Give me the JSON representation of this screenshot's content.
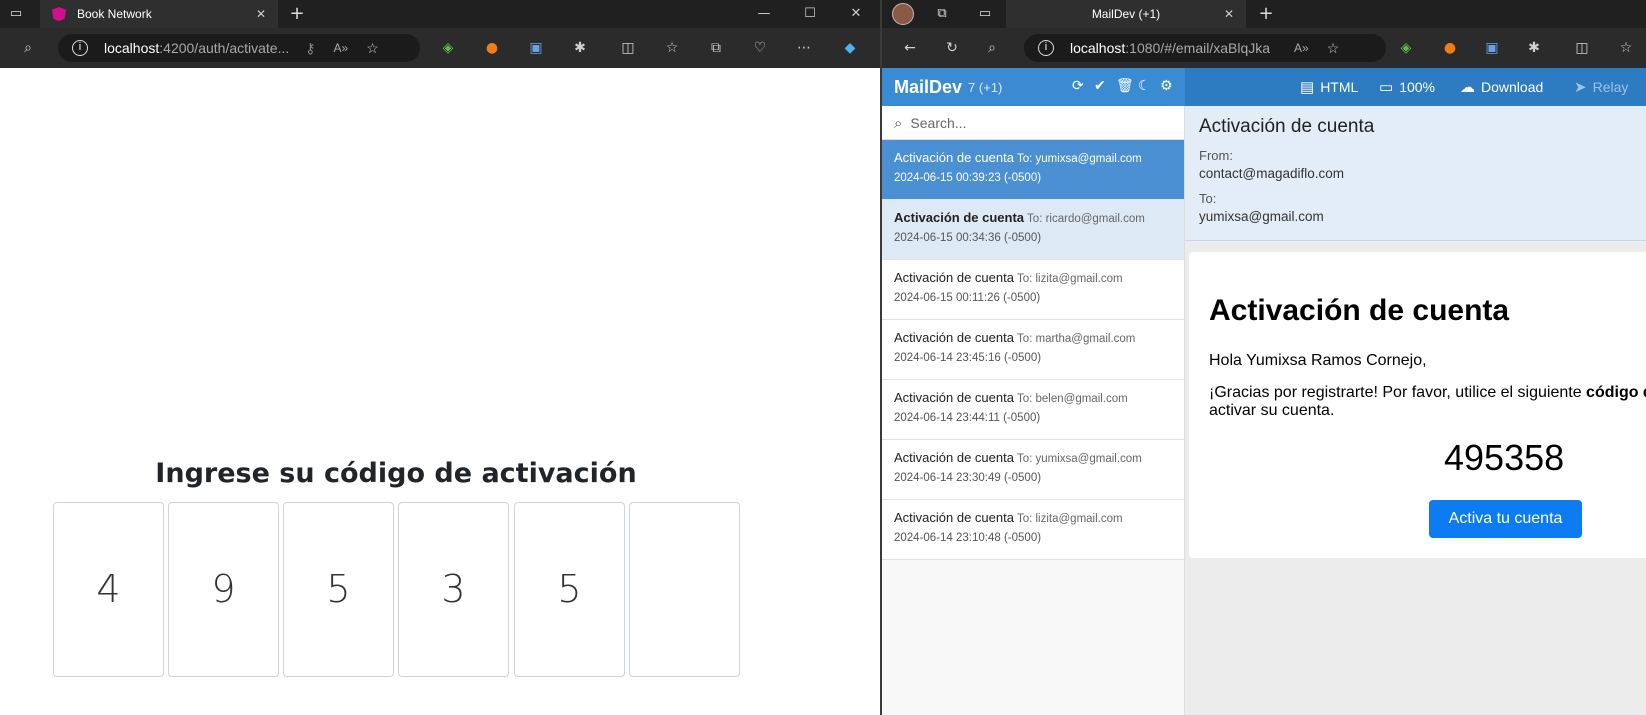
{
  "left_browser": {
    "tab_title": "Book Network",
    "url_host": "localhost",
    "url_rest": ":4200/auth/activate..."
  },
  "activation": {
    "title": "Ingrese su código de activación",
    "digits": [
      "4",
      "9",
      "5",
      "3",
      "5",
      ""
    ]
  },
  "right_browser": {
    "tab_title": "MailDev (+1)",
    "url_host": "localhost",
    "url_rest": ":1080/#/email/xaBlqJka"
  },
  "maildev": {
    "brand": "MailDev",
    "count": "7 (+1)",
    "actions": {
      "html": "HTML",
      "zoom": "100%",
      "download": "Download",
      "relay": "Relay"
    },
    "search_placeholder": "Search...",
    "emails": [
      {
        "subject": "Activación de cuenta",
        "to": "To: yumixsa@gmail.com",
        "date": "2024-06-15 00:39:23 (-0500)"
      },
      {
        "subject": "Activación de cuenta",
        "to": "To: ricardo@gmail.com",
        "date": "2024-06-15 00:34:36 (-0500)"
      },
      {
        "subject": "Activación de cuenta",
        "to": "To: lizita@gmail.com",
        "date": "2024-06-15 00:11:26 (-0500)"
      },
      {
        "subject": "Activación de cuenta",
        "to": "To: martha@gmail.com",
        "date": "2024-06-14 23:45:16 (-0500)"
      },
      {
        "subject": "Activación de cuenta",
        "to": "To: belen@gmail.com",
        "date": "2024-06-14 23:44:11 (-0500)"
      },
      {
        "subject": "Activación de cuenta",
        "to": "To: yumixsa@gmail.com",
        "date": "2024-06-14 23:30:49 (-0500)"
      },
      {
        "subject": "Activación de cuenta",
        "to": "To: lizita@gmail.com",
        "date": "2024-06-14 23:10:48 (-0500)"
      }
    ],
    "detail": {
      "subject": "Activación de cuenta",
      "from_label": "From:",
      "from": "contact@magadiflo.com",
      "to_label": "To:",
      "to": "yumixsa@gmail.com"
    },
    "body": {
      "heading": "Activación de cuenta",
      "greeting": "Hola Yumixsa Ramos Cornejo,",
      "message_part1": "¡Gracias por registrarte! Por favor, utilice el siguiente ",
      "message_bold": "código d",
      "message_part2": "activar su cuenta.",
      "code": "495358",
      "button": "Activa tu cuenta"
    }
  },
  "colors": {
    "maildev_header": "#2d7bc0",
    "selected_item": "#4a90d2",
    "activate_button": "#0d7bf2"
  }
}
